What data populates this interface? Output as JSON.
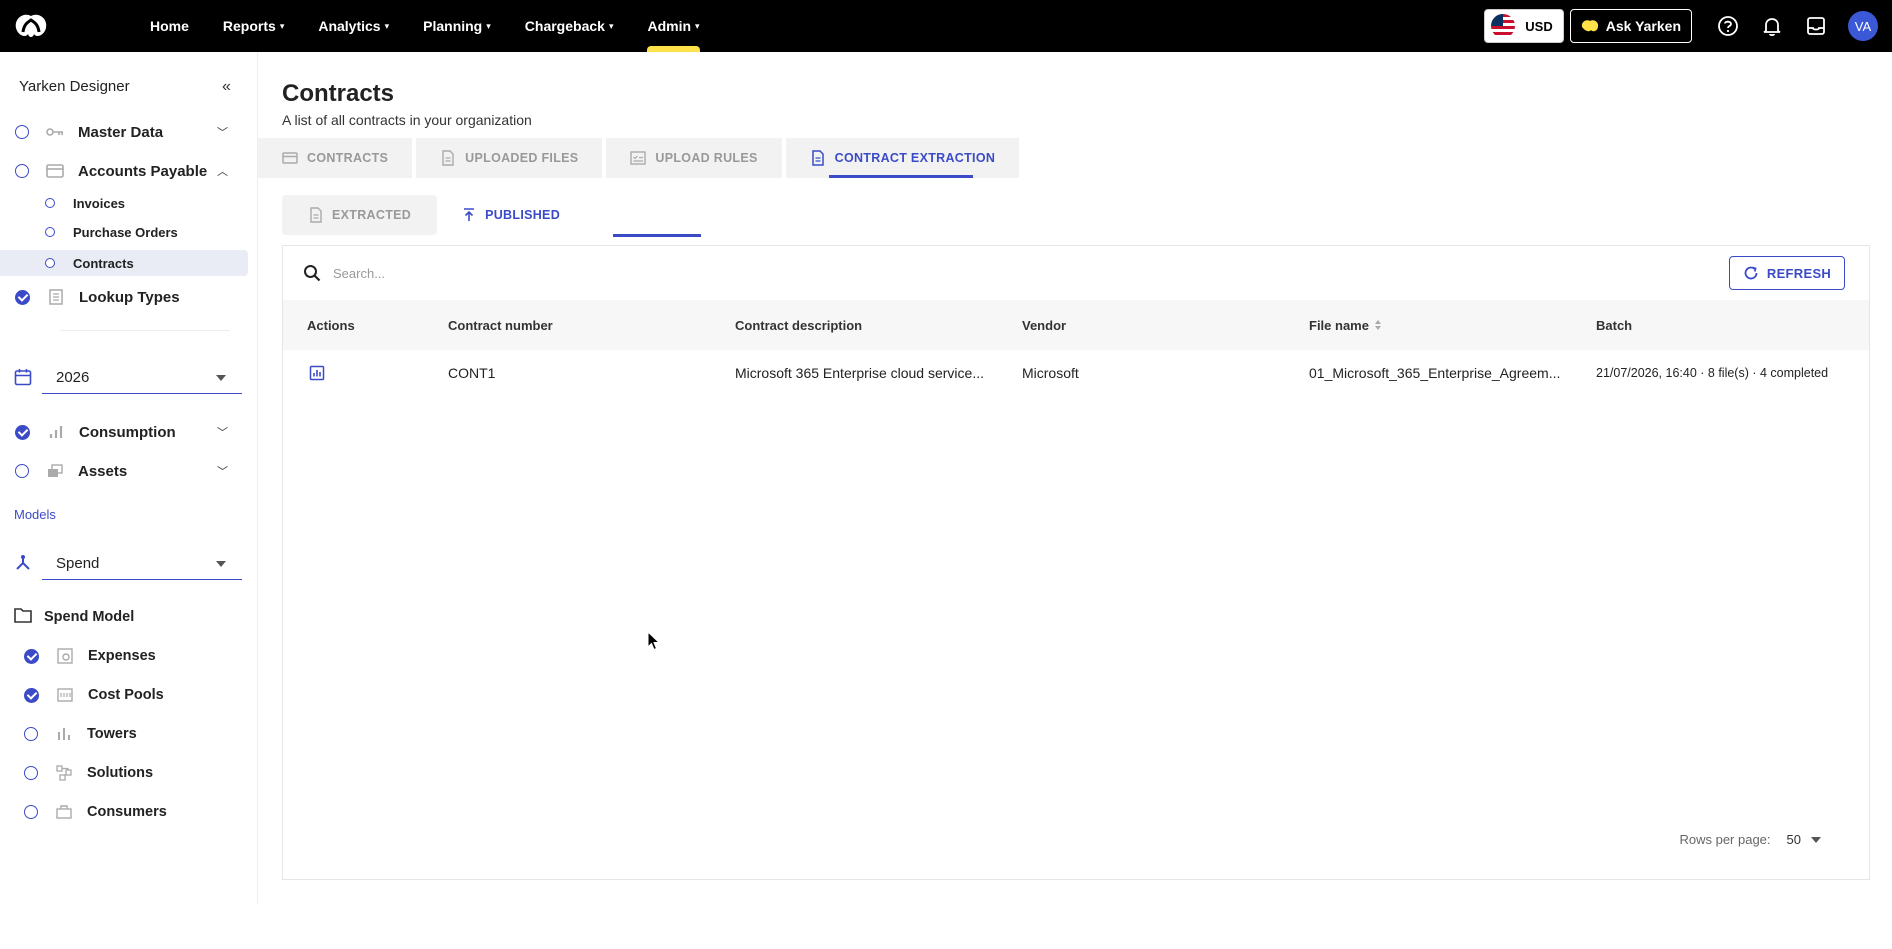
{
  "topbar": {
    "nav": [
      {
        "label": "Home",
        "has_menu": false
      },
      {
        "label": "Reports",
        "has_menu": true
      },
      {
        "label": "Analytics",
        "has_menu": true
      },
      {
        "label": "Planning",
        "has_menu": true
      },
      {
        "label": "Chargeback",
        "has_menu": true
      },
      {
        "label": "Admin",
        "has_menu": true
      }
    ],
    "currency": "USD",
    "ask_label": "Ask Yarken",
    "avatar_initials": "VA",
    "accent_color": "#ffe14a"
  },
  "sidebar": {
    "title": "Yarken Designer",
    "groups": [
      {
        "label": "Master Data",
        "state": "unchecked",
        "icon": "key-icon"
      },
      {
        "label": "Accounts Payable",
        "state": "unchecked",
        "icon": "card-icon"
      },
      {
        "label": "Lookup Types",
        "state": "checked",
        "icon": "list-icon"
      },
      {
        "label": "Consumption",
        "state": "checked",
        "icon": "bar-chart-icon"
      },
      {
        "label": "Assets",
        "state": "unchecked",
        "icon": "assets-icon"
      }
    ],
    "ap_items": [
      {
        "label": "Invoices"
      },
      {
        "label": "Purchase Orders"
      },
      {
        "label": "Contracts",
        "selected": true
      }
    ],
    "year": "2026",
    "models_label": "Models",
    "model": "Spend",
    "spend_model_label": "Spend Model",
    "model_items": [
      {
        "label": "Expenses",
        "state": "checked",
        "icon": "expenses-icon"
      },
      {
        "label": "Cost Pools",
        "state": "checked",
        "icon": "cost-pools-icon"
      },
      {
        "label": "Towers",
        "state": "unchecked",
        "icon": "towers-icon"
      },
      {
        "label": "Solutions",
        "state": "unchecked",
        "icon": "solutions-icon"
      },
      {
        "label": "Consumers",
        "state": "unchecked",
        "icon": "consumers-icon"
      }
    ]
  },
  "main": {
    "title": "Contracts",
    "subtitle": "A list of all contracts in your organization",
    "tabs": [
      {
        "label": "CONTRACTS",
        "active": false
      },
      {
        "label": "UPLOADED FILES",
        "active": false
      },
      {
        "label": "UPLOAD RULES",
        "active": false
      },
      {
        "label": "CONTRACT EXTRACTION",
        "active": true
      }
    ],
    "subtabs": [
      {
        "label": "EXTRACTED",
        "active": false
      },
      {
        "label": "PUBLISHED",
        "active": true
      }
    ],
    "search_placeholder": "Search...",
    "refresh_label": "REFRESH",
    "columns": [
      "Actions",
      "Contract number",
      "Contract description",
      "Vendor",
      "File name",
      "Batch"
    ],
    "rows": [
      {
        "contract_number": "CONT1",
        "description": "Microsoft 365 Enterprise cloud service...",
        "vendor": "Microsoft",
        "file_name": "01_Microsoft_365_Enterprise_Agreem...",
        "batch": "21/07/2026, 16:40 · 8 file(s) · 4 completed"
      }
    ],
    "rows_per_page_label": "Rows per page:",
    "rows_per_page": "50"
  }
}
